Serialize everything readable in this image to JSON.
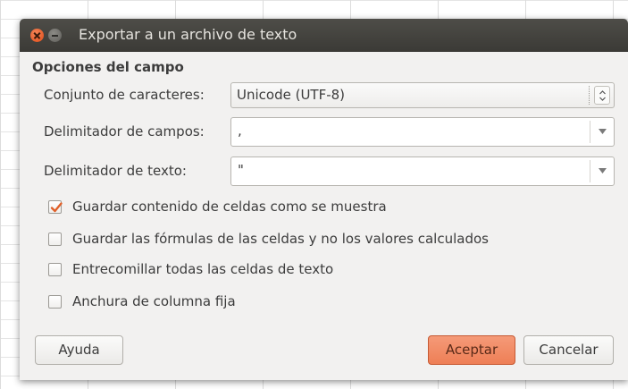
{
  "dialog": {
    "title": "Exportar a un archivo de texto",
    "section_title": "Opciones del campo",
    "charset": {
      "label": "Conjunto de caracteres:",
      "value": "Unicode (UTF-8)"
    },
    "field_delimiter": {
      "label": "Delimitador de campos:",
      "value": ","
    },
    "text_delimiter": {
      "label": "Delimitador de texto:",
      "value": "\""
    },
    "options": [
      {
        "label": "Guardar contenido de celdas como se muestra",
        "checked": true
      },
      {
        "label": "Guardar las fórmulas de las celdas y no los valores calculados",
        "checked": false
      },
      {
        "label": "Entrecomillar todas las celdas de texto",
        "checked": false
      },
      {
        "label": "Anchura de columna fija",
        "checked": false
      }
    ],
    "buttons": {
      "help": "Ayuda",
      "ok": "Aceptar",
      "cancel": "Cancelar"
    }
  },
  "colors": {
    "titlebar": "#3c3b37",
    "close_button": "#e8592b",
    "accent_button": "#f08a63",
    "checkmark": "#e0602a",
    "dialog_bg": "#f2f1f0"
  },
  "icons": [
    "close-icon",
    "minimize-icon",
    "spin-up-icon",
    "spin-down-icon",
    "dropdown-arrow-icon",
    "checkmark-icon"
  ]
}
